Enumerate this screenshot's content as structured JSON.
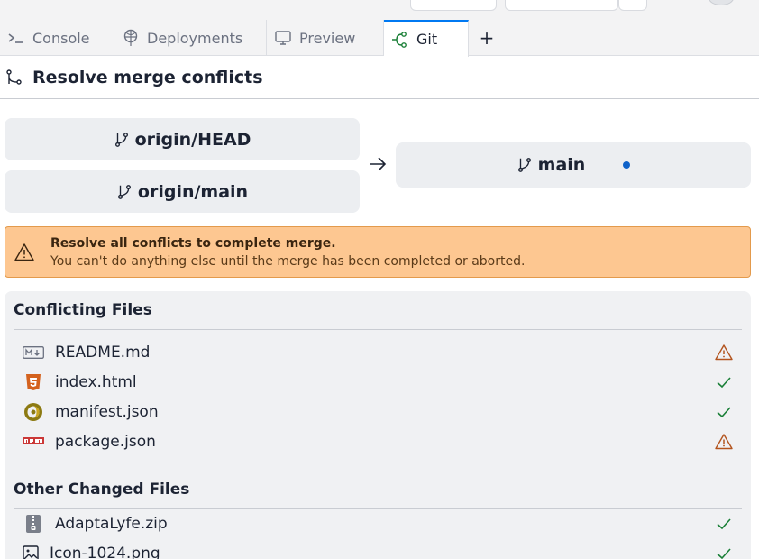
{
  "tabs": [
    {
      "label": "Console",
      "icon": "console-icon",
      "active": false
    },
    {
      "label": "Deployments",
      "icon": "deployments-icon",
      "active": false
    },
    {
      "label": "Preview",
      "icon": "monitor-icon",
      "active": false
    },
    {
      "label": "Git",
      "icon": "git-icon",
      "active": true
    }
  ],
  "tab_add": "+",
  "header": {
    "title": "Resolve merge conflicts",
    "icon": "merge-icon"
  },
  "branches": {
    "incoming": [
      "origin/HEAD",
      "origin/main"
    ],
    "target": "main",
    "target_indicator_color": "#0f62c9"
  },
  "warning": {
    "title": "Resolve all conflicts to complete merge.",
    "body": "You can't do anything else until the merge has been completed or aborted.",
    "background": "#fdc791"
  },
  "conflicting": {
    "title": "Conflicting Files",
    "files": [
      {
        "name": "README.md",
        "icon": "markdown-icon",
        "status": "warning"
      },
      {
        "name": "index.html",
        "icon": "html5-icon",
        "status": "resolved"
      },
      {
        "name": "manifest.json",
        "icon": "json-icon",
        "status": "resolved"
      },
      {
        "name": "package.json",
        "icon": "npm-icon",
        "status": "warning"
      }
    ]
  },
  "other": {
    "title": "Other Changed Files",
    "files": [
      {
        "name": "AdaptaLyfe.zip",
        "icon": "zip-icon",
        "status": "resolved"
      },
      {
        "name": "Icon-1024.png",
        "icon": "image-icon",
        "status": "resolved"
      }
    ]
  },
  "colors": {
    "accent": "#0079f2",
    "ok": "#1a7f37",
    "warn": "#b3541e"
  }
}
